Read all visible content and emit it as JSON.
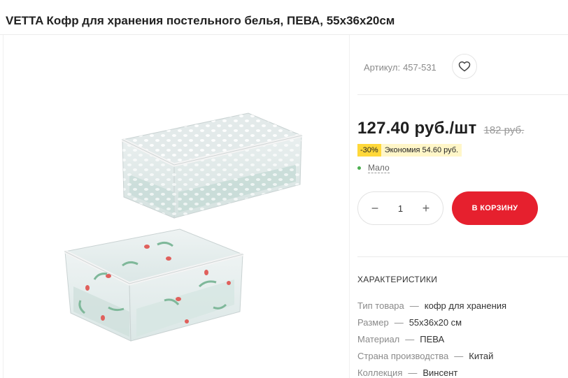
{
  "product": {
    "title": "VETTA Кофр для хранения постельного белья, ПЕВА, 55x36x20см",
    "sku_label": "Артикул:",
    "sku_value": "457-531",
    "price": "127.40 руб./шт",
    "old_price": "182 руб.",
    "discount_percent": "-30%",
    "discount_savings": "Экономия 54.60 руб.",
    "stock": "Мало"
  },
  "cart": {
    "quantity": "1",
    "minus_label": "−",
    "plus_label": "+",
    "add_to_cart_label": "В КОРЗИНУ"
  },
  "specs": {
    "title": "ХАРАКТЕРИСТИКИ",
    "rows": [
      {
        "key": "Тип товара",
        "value": "кофр для хранения"
      },
      {
        "key": "Размер",
        "value": "55x36x20 см"
      },
      {
        "key": "Материал",
        "value": "ПЕВА"
      },
      {
        "key": "Страна производства",
        "value": "Китай"
      },
      {
        "key": "Коллекция",
        "value": "Винсент"
      }
    ],
    "separator": "—"
  },
  "colors": {
    "accent": "#e6202e",
    "discount_badge": "#ffd83a",
    "stock_dot": "#4caf50"
  },
  "icons": {
    "favorite": "heart-icon"
  }
}
